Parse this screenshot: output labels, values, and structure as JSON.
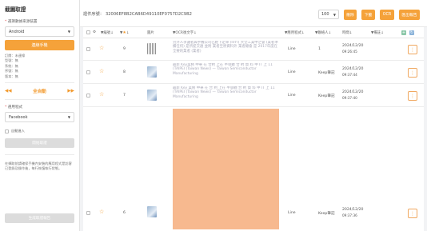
{
  "sidebar": {
    "title": "截圖取證",
    "device_label": "選擇數據來源裝置",
    "device_value": "Android",
    "connect_button": "連線手機",
    "status_lines": [
      "訂閱：未連線",
      "型號：無",
      "系統：無",
      "序號：無",
      "版本：無"
    ],
    "nav_center": "全自動",
    "app_label": "選用程式",
    "app_value": "Facebook",
    "auto_enter_label": "自動進入",
    "start_button": "開始取證",
    "note": "在擷取前請確保手機內安裝的應用程式是訪客已登錄及操作後，每行恢復執行狀態。",
    "bottom_button": "生成取證報告"
  },
  "topbar": {
    "search_label": "證件序號：",
    "search_value": "32006EF8B2CAB6D49110EF0757D2C9B2",
    "page_size": "100",
    "buttons": [
      "刪除",
      "下載",
      "OCR",
      "匯出報告"
    ]
  },
  "table": {
    "headers": [
      "編號",
      "圖片",
      "OCR後文字",
      "應用程式",
      "聯絡人",
      "時間",
      "備註"
    ],
    "rows": [
      {
        "num": "9",
        "ocr": "另外人爭議者與手機公司已經下定單 (Int'l) 大全工業中之會 (業者準備任何) 是所提交通 並附 業者至原資料外 業者總會 是 2017年度在全要的業者 (業者)",
        "app": "Line",
        "contact": "1",
        "date": "2024/12/20",
        "time": "09:26:45"
      },
      {
        "num": "8",
        "ocr": "最新 Key業務 中華 在 合約 上在 半導體 合 約 資 料 中 IT 上 11 (TAIPEI (Taiwan News) — Taiwan Semiconductor Manufacturing",
        "app": "Line",
        "contact": "Keep筆記",
        "date": "2024/12/20",
        "time": "09:37:44"
      },
      {
        "num": "7",
        "ocr": "最新 Key 業務 中華 在 合 約 上在 半導體 合 約 資 料 中 IT 上 11 (TAIPEI (Taiwan News) — Taiwan Semiconductor Manufacturing",
        "app": "Line",
        "contact": "Keep筆記",
        "date": "2024/12/20",
        "time": "09:37:40"
      },
      {
        "num": "6",
        "ocr": "",
        "app": "Line",
        "contact": "Keep筆記",
        "date": "2024/12/20",
        "time": "09:37:36"
      }
    ]
  },
  "colors": {
    "accent": "#f5a23a",
    "muted_button": "#dcdcdc",
    "ocr_highlight": "#f7b98f"
  },
  "icons": {
    "star": "star-icon",
    "more": "more-icon",
    "prev": "double-left-icon",
    "next": "double-right-icon"
  }
}
